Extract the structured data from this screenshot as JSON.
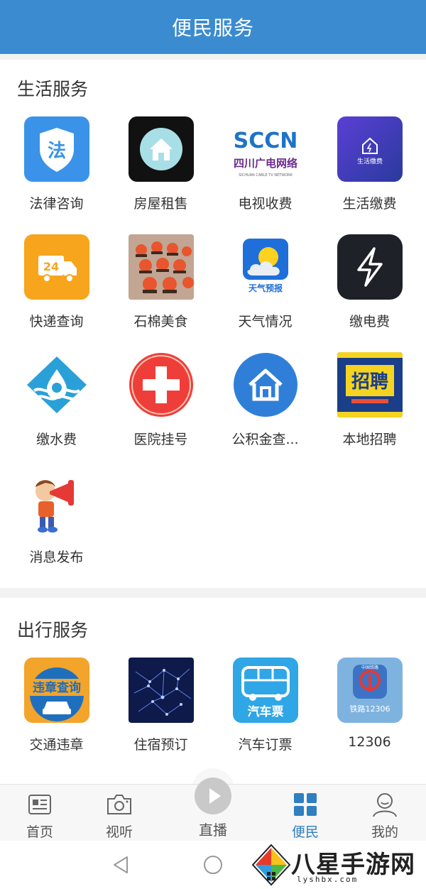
{
  "header": {
    "title": "便民服务"
  },
  "life_section": {
    "title": "生活服务",
    "items": [
      {
        "label": "法律咨询",
        "icon": "law-shield-icon"
      },
      {
        "label": "房屋租售",
        "icon": "house-icon"
      },
      {
        "label": "电视收费",
        "icon": "sccn-tv-logo-icon",
        "logo_text": "SCCN",
        "logo_sub": "四川广电网络",
        "logo_en": "SICHUAN CABLE TV NETWORK"
      },
      {
        "label": "生活缴费",
        "icon": "utility-payment-icon",
        "icon_text": "生活缴费"
      },
      {
        "label": "快递查询",
        "icon": "delivery-truck-icon",
        "icon_text": "24"
      },
      {
        "label": "石棉美食",
        "icon": "food-photo-icon"
      },
      {
        "label": "天气情况",
        "icon": "weather-forecast-icon",
        "icon_text": "天气预报"
      },
      {
        "label": "缴电费",
        "icon": "lightning-icon"
      },
      {
        "label": "缴水费",
        "icon": "water-drop-icon"
      },
      {
        "label": "医院挂号",
        "icon": "medical-cross-icon"
      },
      {
        "label": "公积金查...",
        "icon": "home-fund-icon"
      },
      {
        "label": "本地招聘",
        "icon": "recruitment-icon",
        "icon_text": "招聘"
      },
      {
        "label": "消息发布",
        "icon": "megaphone-kid-icon"
      }
    ]
  },
  "travel_section": {
    "title": "出行服务",
    "items": [
      {
        "label": "交通违章",
        "icon": "traffic-violation-icon",
        "icon_text": "违章查询"
      },
      {
        "label": "住宿预订",
        "icon": "hotel-network-icon"
      },
      {
        "label": "汽车订票",
        "icon": "bus-ticket-icon",
        "icon_text": "汽车票"
      },
      {
        "label": "12306",
        "icon": "railway-12306-icon",
        "icon_text": "铁路12306",
        "icon_sub": "中国铁路"
      }
    ]
  },
  "bottom_nav": {
    "tabs": [
      {
        "label": "首页",
        "icon": "news-icon",
        "active": false
      },
      {
        "label": "视听",
        "icon": "camera-icon",
        "active": false
      },
      {
        "label": "直播",
        "icon": "play-icon",
        "active": false
      },
      {
        "label": "便民",
        "icon": "grid-icon",
        "active": true
      },
      {
        "label": "我的",
        "icon": "profile-icon",
        "active": false
      }
    ]
  },
  "watermark": {
    "text": "八星手游网",
    "url": "lyshbx.com"
  },
  "colors": {
    "header": "#3b8bd0",
    "active_tab": "#2f7fc1"
  }
}
